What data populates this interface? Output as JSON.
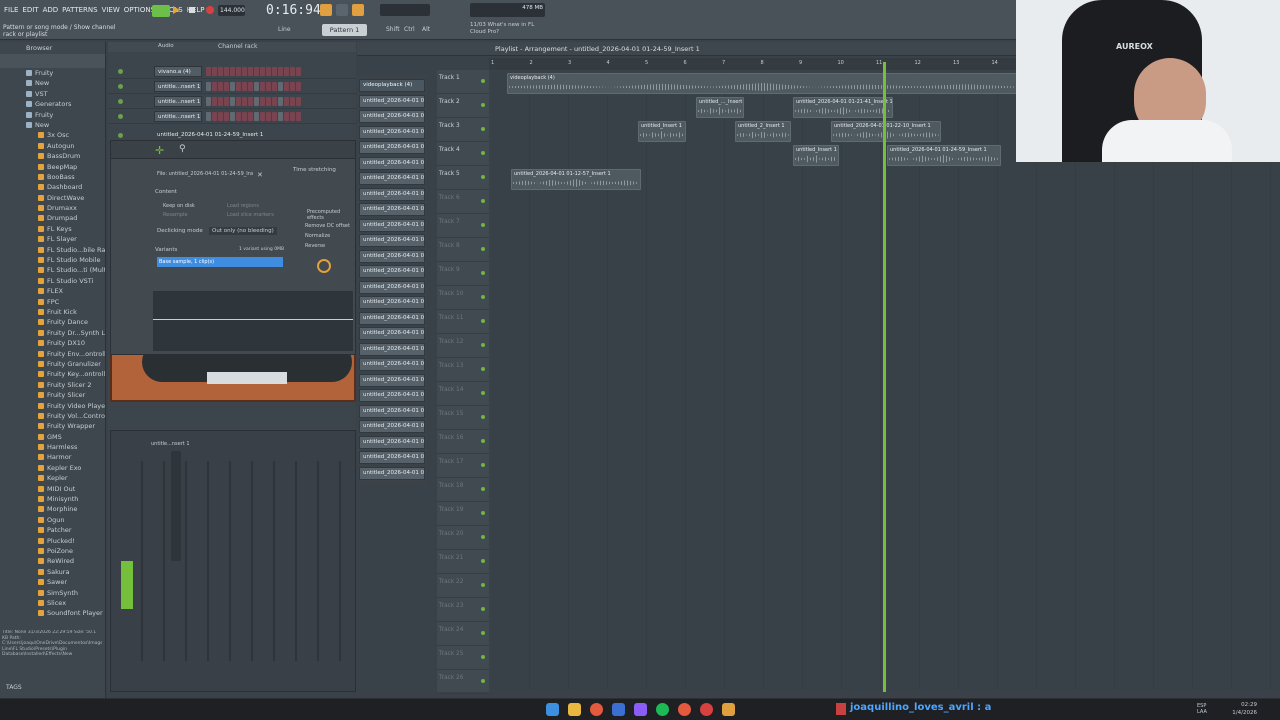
{
  "menu": [
    "FILE",
    "EDIT",
    "ADD",
    "PATTERNS",
    "VIEW",
    "OPTIONS",
    "TOOLS",
    "HELP"
  ],
  "hint": "Pattern or song mode / Show channel rack or playlist",
  "transport": {
    "tempo": "144.000",
    "time": "0:16:94",
    "pattern": "Pattern 1",
    "cpu": "478 MB",
    "news": "11/03 What's new in FL Cloud Pro?"
  },
  "snap": "Line",
  "toolbar_modes": [
    "Shift",
    "Ctrl",
    "Alt"
  ],
  "browser": {
    "header": "Browser",
    "folders": [
      "Fruity",
      "New",
      "VST",
      "Generators",
      "Fruity",
      "New"
    ],
    "plugins": [
      "3x Osc",
      "Autogun",
      "BassDrum",
      "BeepMap",
      "BooBass",
      "Dashboard",
      "DirectWave",
      "Drumaxx",
      "Drumpad",
      "FL Keys",
      "FL Slayer",
      "FL Studio...bile Rack",
      "FL Studio Mobile",
      "FL Studio...ti (Multi)",
      "FL Studio VSTi",
      "FLEX",
      "FPC",
      "Fruit Kick",
      "Fruity Dance",
      "Fruity Dr...Synth Live",
      "Fruity DX10",
      "Fruity Env...ontroller",
      "Fruity Granulizer",
      "Fruity Key...ontroller",
      "Fruity Slicer 2",
      "Fruity Slicer",
      "Fruity Video Player",
      "Fruity Vol...Controller",
      "Fruity Wrapper",
      "GMS",
      "Harmless",
      "Harmor",
      "Kepler Exo",
      "Kepler",
      "MIDI Out",
      "Minisynth",
      "Morphine",
      "Ogun",
      "Patcher",
      "Plucked!",
      "PoiZone",
      "ReWired",
      "Sakura",
      "Sawer",
      "SimSynth",
      "Slicex",
      "Soundfont Player"
    ],
    "tags": "TAGS"
  },
  "channel_rack": {
    "title": "Channel rack",
    "filter": "Audio",
    "channels": [
      "vivano.a (4)",
      "untitle...nsert 1",
      "untitle...nsert 1",
      "untitle...nsert 1",
      "untitled_2026-04-01 01-24-59_Insert 1"
    ],
    "bottom_channels": [
      "untitle...nsert 1",
      "untitle...nsert 1"
    ]
  },
  "sampler": {
    "file": "File: untitled_2026-04-01 01-24-59_Insert 1.wav",
    "content_label": "Content",
    "options": [
      "Keep on disk",
      "Resample",
      "Load regions",
      "Load slice markers"
    ],
    "declicking_label": "Declicking mode",
    "declicking_value": "Out only (no bleeding)",
    "variants_label": "Variants",
    "variants_info": "1 variant using 0MB",
    "variant_selected": "Base sample, 1 clip(s)",
    "time_stretching": "Time stretching",
    "precomputed": "Precomputed effects",
    "effects": [
      "Remove DC offset",
      "Normalize",
      "Reverse"
    ]
  },
  "patterns": [
    "videoplayback (4)",
    "untitled_2026-04-01 00-",
    "untitled_2026-04-01 00-",
    "untitled_2026-04-01 00-",
    "untitled_2026-04-01 00-",
    "untitled_2026-04-01 01-",
    "untitled_2026-04-01 01-",
    "untitled_2026-04-01 01-",
    "untitled_2026-04-01 01-",
    "untitled_2026-04-01 01-",
    "untitled_2026-04-01 01-",
    "untitled_2026-04-01 01-",
    "untitled_2026-04-01 01-",
    "untitled_2026-04-01 01-",
    "untitled_2026-04-01 01-",
    "untitled_2026-04-01 01-",
    "untitled_2026-04-01 01-",
    "untitled_2026-04-01 01-",
    "untitled_2026-04-01 01-",
    "untitled_2026-04-01 01-",
    "untitled_2026-04-01 01-",
    "untitled_2026-04-01 01-",
    "untitled_2026-04-01 01-",
    "untitled_2026-04-01 01-",
    "untitled_2026-04-01 01-",
    "untitled_2026-04-01 01-"
  ],
  "playlist": {
    "title": "Playlist - Arrangement - untitled_2026-04-01 01-24-59_Insert 1",
    "ruler": [
      "1",
      "2",
      "3",
      "4",
      "5",
      "6",
      "7",
      "8",
      "9",
      "10",
      "11",
      "12",
      "13",
      "14"
    ],
    "tracks": [
      "Track 1",
      "Track 2",
      "Track 3",
      "Track 4",
      "Track 5",
      "Track 6",
      "Track 7",
      "Track 8",
      "Track 9",
      "Track 10",
      "Track 11",
      "Track 12",
      "Track 13",
      "Track 14",
      "Track 15",
      "Track 16",
      "Track 17",
      "Track 18",
      "Track 19",
      "Track 20",
      "Track 21",
      "Track 22",
      "Track 23",
      "Track 24",
      "Track 25",
      "Track 26"
    ],
    "clips": [
      "videoplayback (4)",
      "untitled_..._Insert 1",
      "untitled_2026-04-01 01-21-41_Insert 1",
      "untitled_Insert 1",
      "untitled_2_Insert 1",
      "untitled_2026-04-01 01-22-10_Insert 1",
      "untitled_Insert 1",
      "untitled_2026-04-01 01-24-59_Insert 1",
      "untitled_2026-04-01 01-12-57_Insert 1"
    ]
  },
  "file_info": "Title: None  31/3/2026 22:29:59  Size: 50.1 KB  Path: C:\\Users\\joaqu\\OneDrive\\Documentos\\Image-Line\\FL Studio\\Presets\\Plugin Database\\Installed\\Effects\\New",
  "webcam_brand": "AUREOX",
  "taskbar": {
    "chat": "joaquillino_loves_avril : a",
    "lang": "ESP LAA",
    "time": "02:29",
    "date": "1/4/2026"
  },
  "colors": {
    "accent": "#74c03c",
    "orange": "#e0a040",
    "bg": "#3a4148",
    "selection": "#3f8de0"
  }
}
